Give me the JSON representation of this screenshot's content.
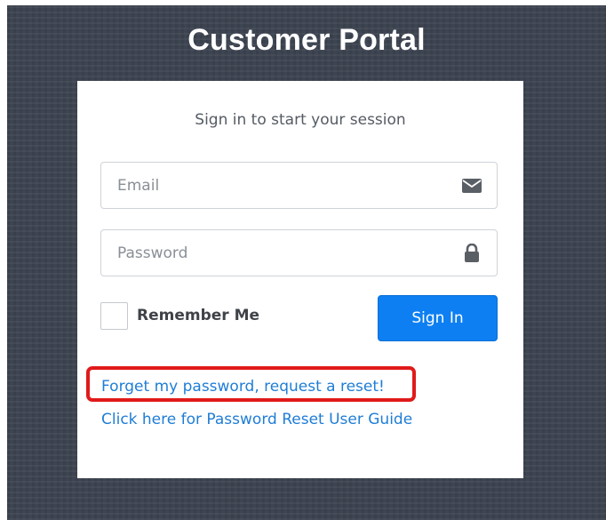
{
  "page": {
    "title": "Customer Portal"
  },
  "login": {
    "subtitle": "Sign in to start your session",
    "email": {
      "placeholder": "Email",
      "value": "",
      "icon": "envelope-icon"
    },
    "password": {
      "placeholder": "Password",
      "value": "",
      "icon": "lock-icon"
    },
    "remember_label": "Remember Me",
    "remember_checked": false,
    "signin_label": "Sign In",
    "signin_color": "#0d7ff2"
  },
  "links": {
    "reset_password": "Forget my password, request a reset!",
    "reset_guide": "Click here for Password Reset User Guide",
    "link_color": "#1f7dd6"
  },
  "annotation": {
    "highlight_color": "#e01b1b",
    "highlight_target": "reset_password"
  }
}
